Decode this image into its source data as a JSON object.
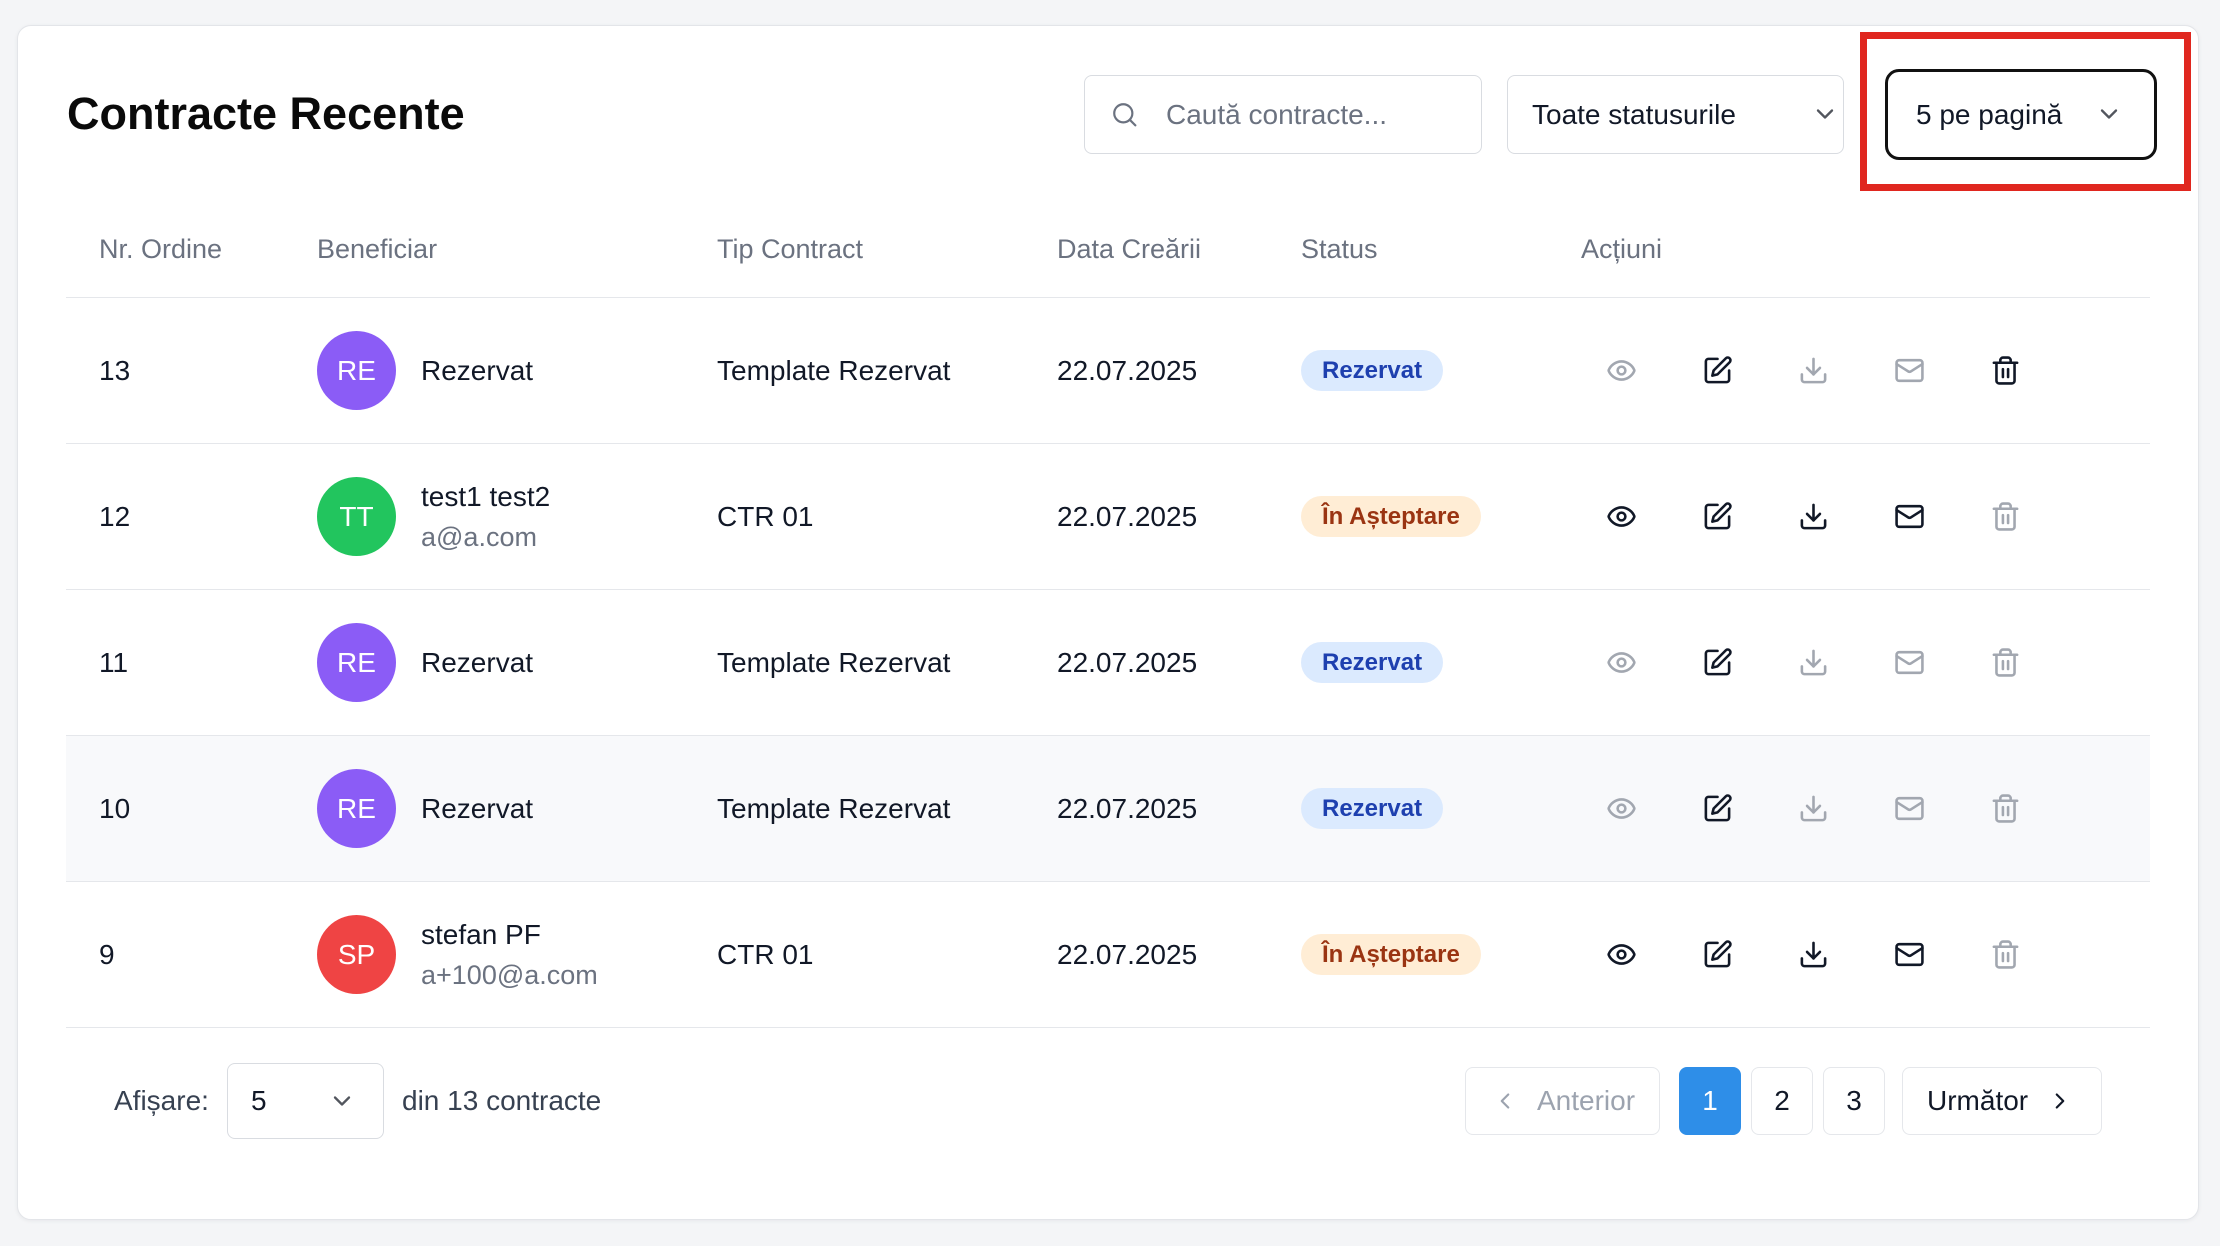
{
  "header": {
    "title": "Contracte Recente",
    "search": {
      "placeholder": "Caută contracte...",
      "icon": "search-icon"
    },
    "status_filter": {
      "selected": "Toate statusurile",
      "icon": "chevron-down-icon"
    },
    "page_size_select": {
      "selected": "5 pe pagină",
      "icon": "chevron-down-icon",
      "focused": true
    }
  },
  "highlight": {
    "color": "#e0271f"
  },
  "table": {
    "columns": [
      "Nr. Ordine",
      "Beneficiar",
      "Tip Contract",
      "Data Creării",
      "Status",
      "Acțiuni"
    ],
    "action_icons": [
      "eye-icon",
      "edit-icon",
      "download-icon",
      "mail-icon",
      "trash-icon"
    ],
    "rows": [
      {
        "nr": "13",
        "initials": "RE",
        "avatar_color": "#8b5cf6",
        "name": "Rezervat",
        "contract_type": "Template Rezervat",
        "created": "22.07.2025",
        "status": "Rezervat",
        "actions_enabled": [
          false,
          true,
          false,
          false,
          true
        ]
      },
      {
        "nr": "12",
        "initials": "TT",
        "avatar_color": "#22c55e",
        "name": "test1 test2",
        "email": "a@a.com",
        "contract_type": "CTR 01",
        "created": "22.07.2025",
        "status": "În Așteptare",
        "actions_enabled": [
          true,
          true,
          true,
          true,
          false
        ]
      },
      {
        "nr": "11",
        "initials": "RE",
        "avatar_color": "#8b5cf6",
        "name": "Rezervat",
        "contract_type": "Template Rezervat",
        "created": "22.07.2025",
        "status": "Rezervat",
        "actions_enabled": [
          false,
          true,
          false,
          false,
          false
        ]
      },
      {
        "nr": "10",
        "initials": "RE",
        "avatar_color": "#8b5cf6",
        "name": "Rezervat",
        "contract_type": "Template Rezervat",
        "created": "22.07.2025",
        "status": "Rezervat",
        "actions_enabled": [
          false,
          true,
          false,
          false,
          false
        ],
        "hovered": true
      },
      {
        "nr": "9",
        "initials": "SP",
        "avatar_color": "#ef4444",
        "name": "stefan PF",
        "email": "a+100@a.com",
        "contract_type": "CTR 01",
        "created": "22.07.2025",
        "status": "În Așteptare",
        "actions_enabled": [
          true,
          true,
          true,
          true,
          false
        ]
      }
    ]
  },
  "footer": {
    "show_label": "Afișare:",
    "page_size": {
      "selected": "5",
      "icon": "chevron-down-icon"
    },
    "total_text": "din 13 contracte",
    "pagination": {
      "prev_label": "Anterior",
      "prev_enabled": false,
      "prev_icon": "chevron-left-icon",
      "pages": [
        "1",
        "2",
        "3"
      ],
      "current_page": "1",
      "next_label": "Următor",
      "next_enabled": true,
      "next_icon": "chevron-right-icon"
    }
  },
  "colors": {
    "page_background": "#f4f5f7",
    "text": "#111827",
    "muted_text": "#6b7280",
    "disabled_icon": "#a2a7b0",
    "active_page": "#2e8ee8",
    "status": {
      "Rezervat": {
        "background": "#dbeafe",
        "text": "#1e40af"
      },
      "În Așteptare": {
        "background": "#ffedd5",
        "text": "#9a3412"
      }
    }
  }
}
